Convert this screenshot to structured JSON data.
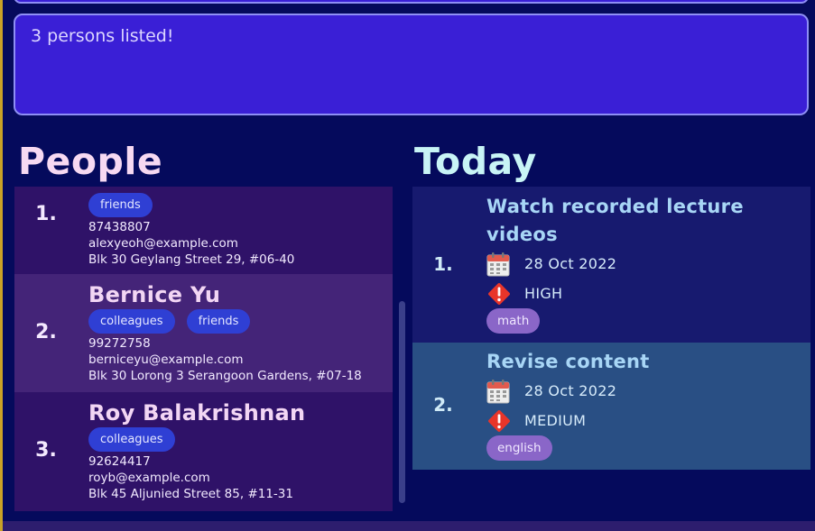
{
  "result_display": {
    "text": "3 persons listed!"
  },
  "sections": {
    "people_title": "People",
    "today_title": "Today"
  },
  "people": [
    {
      "index": "1.",
      "name": "",
      "tags": [
        "friends"
      ],
      "phone": "87438807",
      "email": "alexyeoh@example.com",
      "address": "Blk 30 Geylang Street 29, #06-40",
      "bg": "#2f1268"
    },
    {
      "index": "2.",
      "name": "Bernice Yu",
      "tags": [
        "colleagues",
        "friends"
      ],
      "phone": "99272758",
      "email": "berniceyu@example.com",
      "address": "Blk 30 Lorong 3 Serangoon Gardens, #07-18",
      "bg": "#442478"
    },
    {
      "index": "3.",
      "name": "Roy Balakrishnan",
      "tags": [
        "colleagues"
      ],
      "phone": "92624417",
      "email": "royb@example.com",
      "address": "Blk 45 Aljunied Street 85, #11-31",
      "bg": "#2f1268"
    }
  ],
  "tasks": [
    {
      "index": "1.",
      "title": "Watch recorded lecture videos",
      "date": "28 Oct 2022",
      "priority": "HIGH",
      "tag": "math",
      "bg": "#171a6f"
    },
    {
      "index": "2.",
      "title": "Revise content",
      "date": "28 Oct 2022",
      "priority": "MEDIUM",
      "tag": "english",
      "bg": "#294f84"
    }
  ],
  "icons": {
    "date": "calendar-icon",
    "priority": "priority-warning-icon"
  }
}
